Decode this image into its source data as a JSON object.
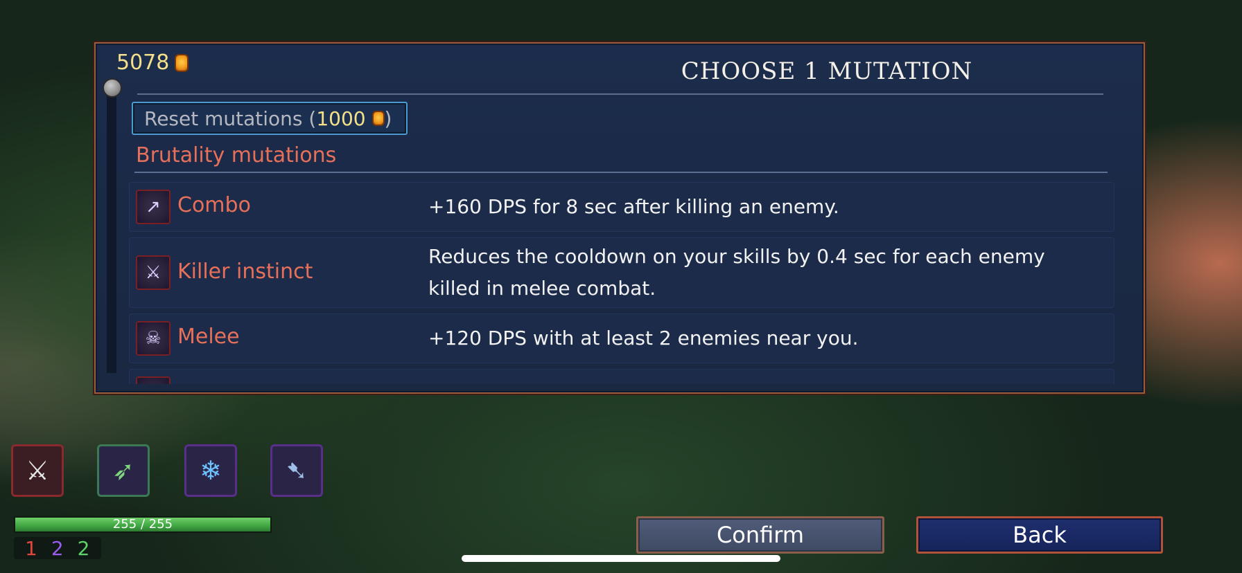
{
  "header": {
    "coins": "5078",
    "title": "CHOOSE 1 MUTATION"
  },
  "reset": {
    "label": "Reset mutations (",
    "cost": "1000",
    "suffix": ")"
  },
  "section": {
    "label": "Brutality mutations"
  },
  "mutations": [
    {
      "name": "Combo",
      "description": "+160 DPS for 8 sec after killing an enemy.",
      "icon": "crossbow-icon"
    },
    {
      "name": "Killer instinct",
      "description": "Reduces the cooldown on your skills by 0.4 sec for each enemy killed in melee combat.",
      "icon": "dagger-icon"
    },
    {
      "name": "Melee",
      "description": "+120 DPS with at least 2 enemies near you.",
      "icon": "sword-creature-icon"
    }
  ],
  "skills": [
    {
      "icon": "crossed-swords-icon",
      "color": "#8a2a2e"
    },
    {
      "icon": "bow-icon",
      "color": "#3c7a56"
    },
    {
      "icon": "ice-orb-icon",
      "color": "#5a2f8a"
    },
    {
      "icon": "shield-spear-icon",
      "color": "#5a2f8a"
    }
  ],
  "health": {
    "text": "255 / 255",
    "fraction": 1.0
  },
  "counters": {
    "red": "1",
    "purple": "2",
    "green": "2"
  },
  "actions": {
    "confirm": "Confirm",
    "back": "Back"
  },
  "colors": {
    "accent_red": "#e7705a",
    "gold": "#f4e08a",
    "panel": "#1c2c4c",
    "border": "#9b5c3e"
  }
}
